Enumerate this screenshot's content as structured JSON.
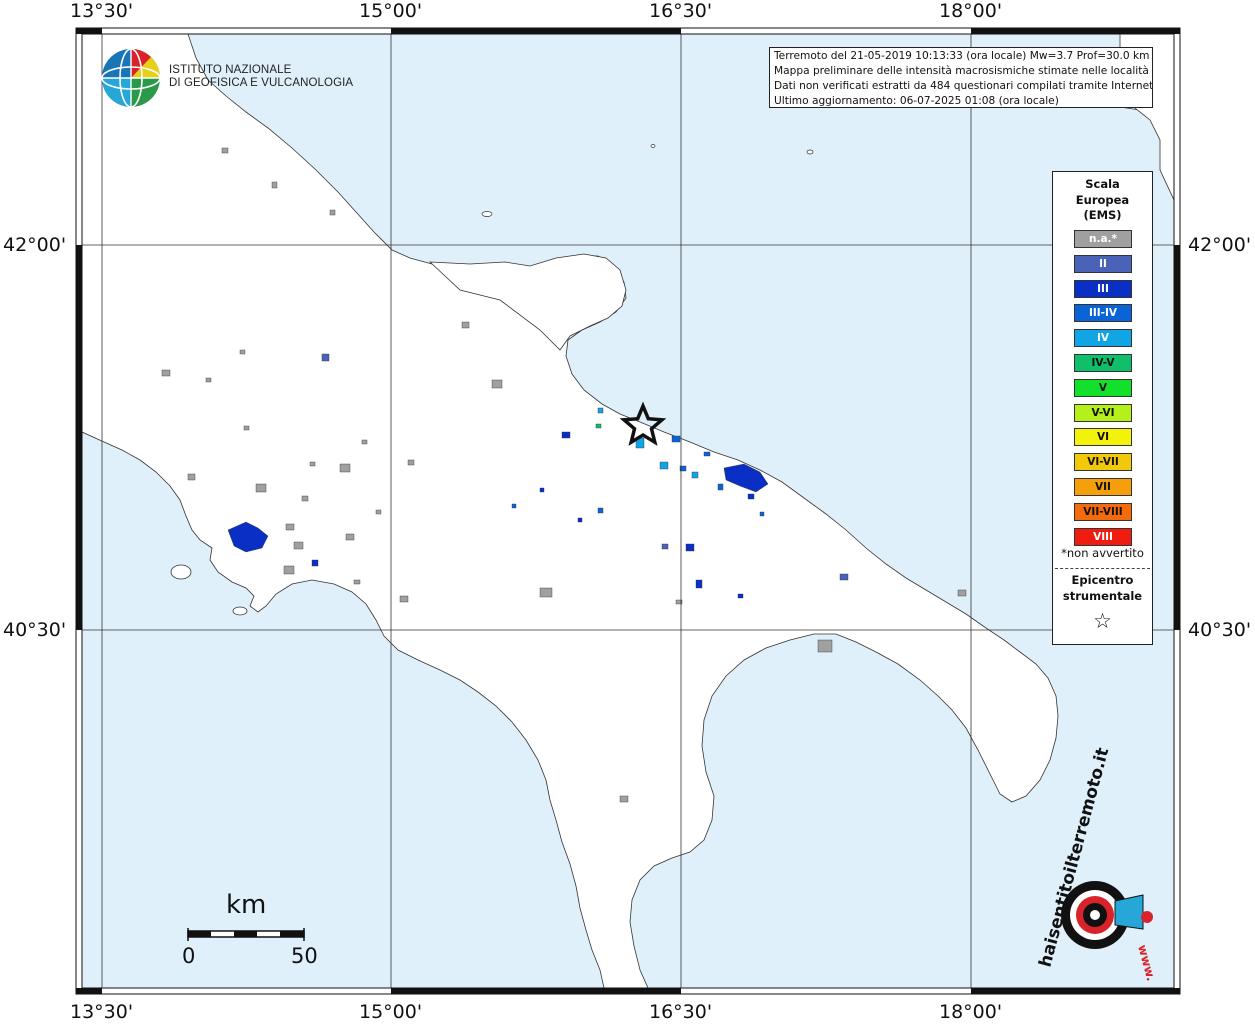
{
  "map": {
    "lon_labels": [
      "13°30'",
      "15°00'",
      "16°30'",
      "18°00'"
    ],
    "lat_labels": [
      "42°00'",
      "40°30'"
    ],
    "epicenter_icon": "star-icon"
  },
  "info": {
    "line1": "Terremoto del 21-05-2019 10:13:33 (ora locale) Mw=3.7 Prof=30.0 km",
    "line2": "Mappa preliminare delle intensità macrosismiche stimate nelle località",
    "line3": "Dati non verificati estratti da 484 questionari compilati tramite Internet.",
    "line4": "Ultimo aggiornamento: 06-07-2025 01:08 (ora locale)"
  },
  "legend": {
    "title_line1": "Scala",
    "title_line2": "Europea",
    "title_line3": "(EMS)",
    "classes": [
      {
        "label": "n.a.*",
        "color": "#a0a0a0"
      },
      {
        "label": "II",
        "color": "#4a63b8"
      },
      {
        "label": "III",
        "color": "#0a2fc4"
      },
      {
        "label": "III-IV",
        "color": "#0a64d8"
      },
      {
        "label": "IV",
        "color": "#10a6e6"
      },
      {
        "label": "IV-V",
        "color": "#0fbf6a"
      },
      {
        "label": "V",
        "color": "#12e02a"
      },
      {
        "label": "V-VI",
        "color": "#b4f01a"
      },
      {
        "label": "VI",
        "color": "#f2f20a"
      },
      {
        "label": "VI-VII",
        "color": "#f2c80a"
      },
      {
        "label": "VII",
        "color": "#f5a00a"
      },
      {
        "label": "VII-VIII",
        "color": "#f56a0a"
      },
      {
        "label": "VIII",
        "color": "#ef1d10"
      }
    ],
    "note": "*non avvertito",
    "epicenter_line1": "Epicentro",
    "epicenter_line2": "strumentale",
    "epicenter_icon": "star-icon"
  },
  "logos": {
    "ingv_line1": "ISTITUTO NAZIONALE",
    "ingv_line2": "DI GEOFISICA E VULCANOLOGIA",
    "hst_text": "haisentitoilterremoto.it",
    "hst_www": "www."
  },
  "scalebar": {
    "unit": "km",
    "start": "0",
    "end": "50"
  },
  "colors": {
    "sea": "#dff0fb",
    "land": "#ffffff",
    "na": "#a0a0a0",
    "ii": "#4a63b8",
    "iii": "#0a2fc4",
    "iii_iv": "#0a64d8",
    "iv": "#10a6e6",
    "iv_v": "#0fbf6a"
  }
}
